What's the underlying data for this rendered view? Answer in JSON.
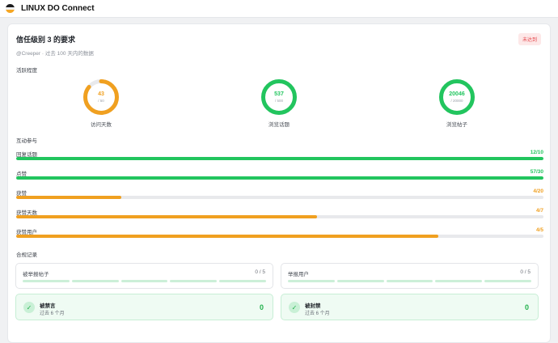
{
  "app": {
    "title": "LINUX DO Connect",
    "logo_colors": [
      "#1c1c1e",
      "#f0f0f0",
      "#f5a623"
    ]
  },
  "header": {
    "title": "信任级别 3 的要求",
    "status_badge": "未达到",
    "subtitle": "@Creeper · 过去 100 天内的数据"
  },
  "activity": {
    "section_label": "活跃程度",
    "rings": [
      {
        "value": "43",
        "max_label": "/ 50",
        "label": "访问天数",
        "progress": 0.86,
        "color": "#f0a020"
      },
      {
        "value": "537",
        "max_label": "/ 500",
        "label": "浏览话题",
        "progress": 1.0,
        "color": "#22c55e"
      },
      {
        "value": "20046",
        "max_label": "/ 20000",
        "label": "浏览帖子",
        "progress": 1.0,
        "color": "#22c55e"
      }
    ]
  },
  "interaction": {
    "section_label": "互动参与",
    "bars": [
      {
        "label": "回复话题",
        "count": "12/10",
        "progress": 1.0,
        "color": "#22c55e"
      },
      {
        "label": "点赞",
        "count": "57/30",
        "progress": 1.0,
        "color": "#22c55e"
      },
      {
        "label": "获赞",
        "count": "4/20",
        "progress": 0.2,
        "color": "#f0a020"
      },
      {
        "label": "获赞天数",
        "count": "4/7",
        "progress": 0.571,
        "color": "#f0a020"
      },
      {
        "label": "获赞用户",
        "count": "4/5",
        "progress": 0.8,
        "color": "#f0a020"
      }
    ]
  },
  "compliance": {
    "section_label": "合规记录",
    "reports": [
      {
        "label": "被举报帖子",
        "count": "0 / 5"
      },
      {
        "label": "举报用户",
        "count": "0 / 5"
      }
    ],
    "statuses": [
      {
        "title": "被禁言",
        "subtitle": "过去 6 个月",
        "count": "0"
      },
      {
        "title": "被封禁",
        "subtitle": "过去 6 个月",
        "count": "0"
      }
    ]
  }
}
